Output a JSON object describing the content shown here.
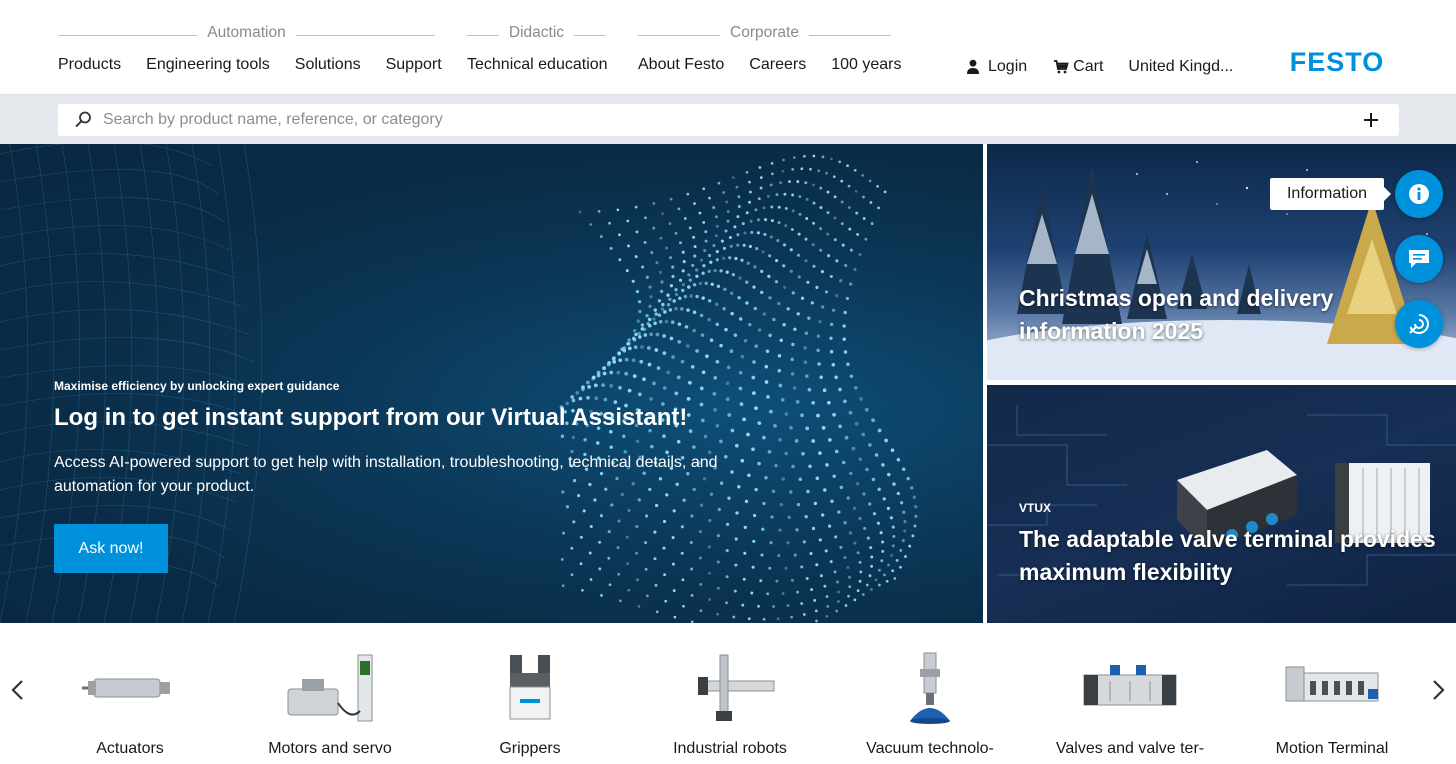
{
  "header": {
    "groups": [
      {
        "title": "Automation",
        "links": [
          "Products",
          "Engineering tools",
          "Solutions",
          "Support"
        ]
      },
      {
        "title": "Didactic",
        "links": [
          "Technical education"
        ]
      },
      {
        "title": "Corporate",
        "links": [
          "About Festo",
          "Careers",
          "100 years"
        ]
      }
    ],
    "login": "Login",
    "cart": "Cart",
    "region": "United Kingd...",
    "logo": "FESTO",
    "brand_color": "#0091dc"
  },
  "search": {
    "placeholder": "Search by product name, reference, or category"
  },
  "hero": {
    "kicker": "Maximise efficiency by unlocking expert guidance",
    "title": "Log in to get instant support from our Virtual Assistant!",
    "text": "Access AI-powered support to get help with installation, troubleshooting, technical details, and automation for your product.",
    "button": "Ask now!"
  },
  "tiles": {
    "xmas": {
      "title_line1": "Christmas open and delivery",
      "title_line2": "information 2025"
    },
    "vtux": {
      "kicker": "VTUX",
      "title_line1": "The adaptable valve terminal provides",
      "title_line2": "maximum flexibility"
    }
  },
  "side_actions": {
    "tooltip": "Information",
    "icons": [
      "info-icon",
      "chat-icon",
      "feedback-icon"
    ]
  },
  "categories": [
    "Actuators",
    "Motors and servo",
    "Grippers",
    "Industrial robots",
    "Vacuum technolo-",
    "Valves and valve ter-",
    "Motion Terminal"
  ]
}
